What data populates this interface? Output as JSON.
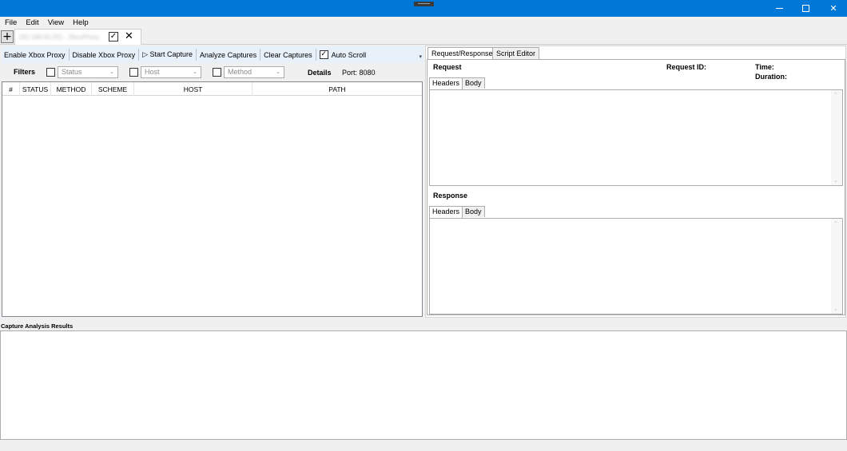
{
  "window": {
    "title_controls": {
      "minimize": "—",
      "maximize": "☐",
      "close": "✕"
    }
  },
  "menu": [
    "File",
    "Edit",
    "View",
    "Help"
  ],
  "tabs": {
    "add_label": "+",
    "doc_tab": {
      "title": "192.168.50.201 - XboxProxy",
      "checked": "✓",
      "close": "✕"
    }
  },
  "toolbar": {
    "enable_proxy": "Enable Xbox Proxy",
    "disable_proxy": "Disable Xbox Proxy",
    "start_capture": "▷ Start Capture",
    "analyze": "Analyze Captures",
    "clear": "Clear Captures",
    "auto_scroll_check": "✓",
    "auto_scroll": "Auto Scroll",
    "overflow": "▾"
  },
  "filters": {
    "label": "Filters",
    "status_placeholder": "Status",
    "host_placeholder": "Host",
    "method_placeholder": "Method",
    "chevron": "⌄",
    "details": "Details",
    "port": "Port: 8080"
  },
  "capture_list": {
    "columns": [
      "#",
      "STATUS",
      "METHOD",
      "SCHEME",
      "HOST",
      "PATH"
    ]
  },
  "right_panel": {
    "tabs": [
      "Request/Response",
      "Script Editor"
    ],
    "request": {
      "label": "Request",
      "request_id": "Request ID:",
      "time": "Time:",
      "duration": "Duration:",
      "subtabs": [
        "Headers",
        "Body"
      ]
    },
    "response": {
      "label": "Response",
      "subtabs": [
        "Headers",
        "Body"
      ]
    },
    "scroll_up": "⌃",
    "scroll_down": "⌄"
  },
  "analysis": {
    "label": "Capture Analysis Results"
  },
  "colors": {
    "titlebar": "#0078d7",
    "toolbar": "#e8f0fa"
  }
}
